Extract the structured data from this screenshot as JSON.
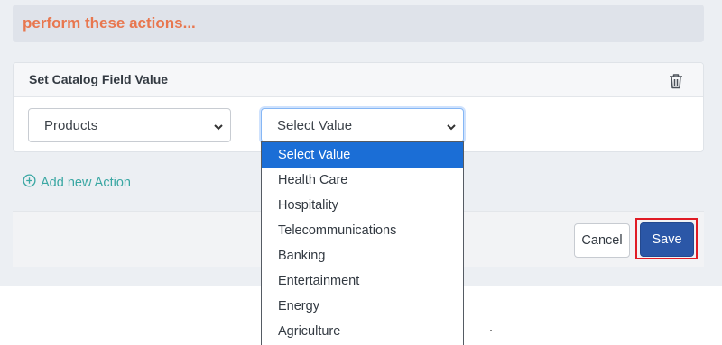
{
  "header": {
    "title": "perform these actions..."
  },
  "card": {
    "title": "Set Catalog Field Value",
    "field_select": {
      "value": "Products"
    },
    "value_select": {
      "value": "Select Value"
    }
  },
  "add_action_label": "Add new Action",
  "dropdown": {
    "options": [
      "Select Value",
      "Health Care",
      "Hospitality",
      "Telecommunications",
      "Banking",
      "Entertainment",
      "Energy",
      "Agriculture"
    ],
    "selected_index": 0
  },
  "footer": {
    "cancel_label": "Cancel",
    "save_label": "Save"
  },
  "icons": {
    "delete": "trash-icon",
    "add": "plus-circle-icon",
    "caret": "chevron-down-icon"
  },
  "colors": {
    "header_title": "#e8774f",
    "add_action": "#3aa7a3",
    "save_button": "#2b57a7",
    "highlight_outline": "#e01b24",
    "selected_option": "#1b6ed6"
  }
}
